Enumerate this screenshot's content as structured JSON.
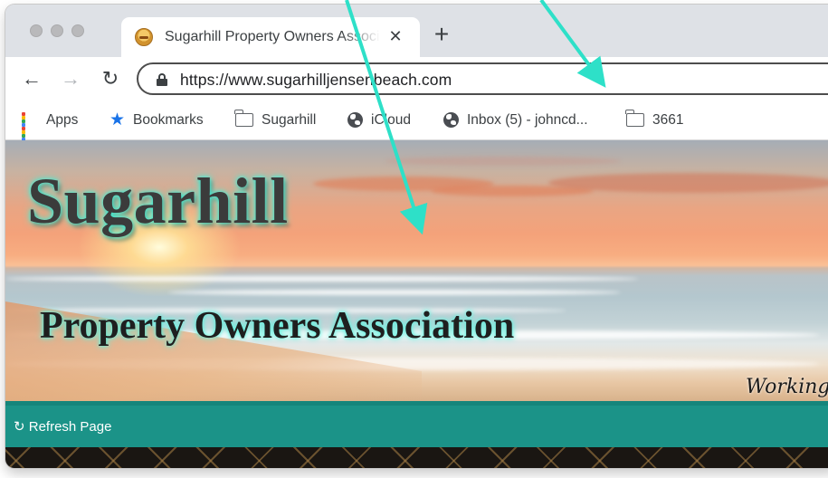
{
  "browser": {
    "tab": {
      "title": "Sugarhill Property Owners Association",
      "close_glyph": "✕"
    },
    "new_tab_glyph": "+",
    "nav": {
      "back": "←",
      "forward": "→",
      "reload": "↻"
    },
    "url": "https://www.sugarhilljensenbeach.com",
    "bookmarks": [
      {
        "label": "Apps",
        "icon": "apps-grid-icon"
      },
      {
        "label": "Bookmarks",
        "icon": "star-icon"
      },
      {
        "label": "Sugarhill",
        "icon": "folder-icon"
      },
      {
        "label": "iCloud",
        "icon": "globe-icon"
      },
      {
        "label": "Inbox (5) - johncd...",
        "icon": "globe-icon"
      },
      {
        "label": "3661",
        "icon": "folder-icon"
      }
    ]
  },
  "page": {
    "title": "Sugarhill",
    "subtitle": "Property Owners Association",
    "tagline": "Working T",
    "refresh_label": "↻ Refresh Page"
  },
  "colors": {
    "arrow": "#2ee0c8",
    "refresh_bar": "#1b9388",
    "title_glow": "#3ff0d8",
    "bookmark_star": "#1a73e8"
  }
}
